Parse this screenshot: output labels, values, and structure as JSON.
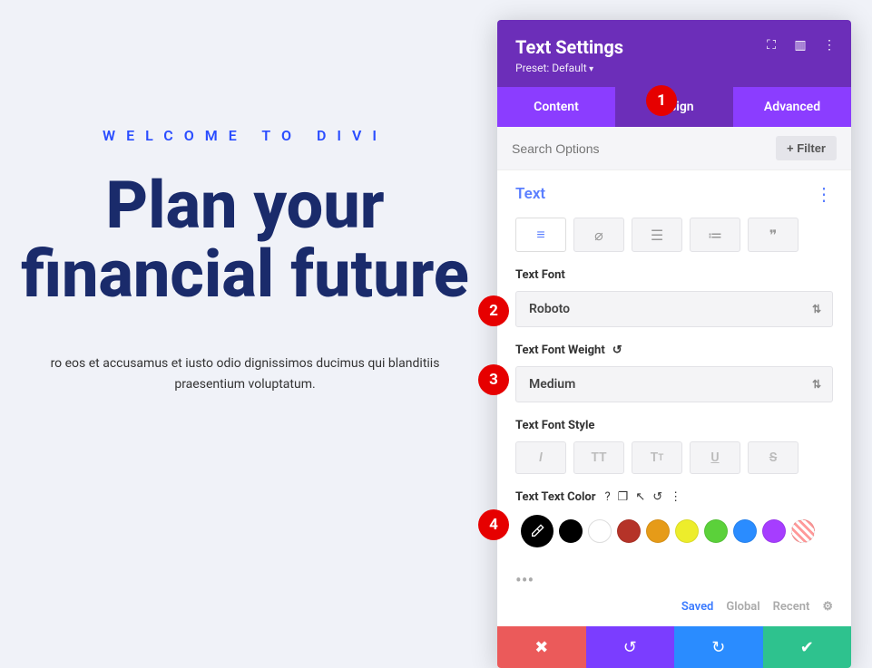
{
  "page": {
    "welcome": "WELCOME TO DIVI",
    "headline": "Plan your financial future",
    "subtext": "ro eos et accusamus et iusto odio dignissimos ducimus qui blanditiis praesentium voluptatum."
  },
  "panel": {
    "title": "Text Settings",
    "preset": "Preset: Default",
    "tabs": {
      "content": "Content",
      "design": "Design",
      "advanced": "Advanced",
      "active": "design"
    },
    "search_placeholder": "Search Options",
    "filter_label": "+  Filter",
    "section_title": "Text",
    "font_label": "Text Font",
    "font_value": "Roboto",
    "weight_label": "Text Font Weight",
    "weight_value": "Medium",
    "style_label": "Text Font Style",
    "color_label": "Text Text Color",
    "swatches": [
      "#000000",
      "#000000",
      "#ffffff",
      "#b53328",
      "#e69b18",
      "#eded2b",
      "#5bd13a",
      "#2a8cff",
      "#a63dff"
    ],
    "color_tabs": {
      "saved": "Saved",
      "global": "Global",
      "recent": "Recent"
    }
  },
  "badges": {
    "b1": "1",
    "b2": "2",
    "b3": "3",
    "b4": "4"
  }
}
